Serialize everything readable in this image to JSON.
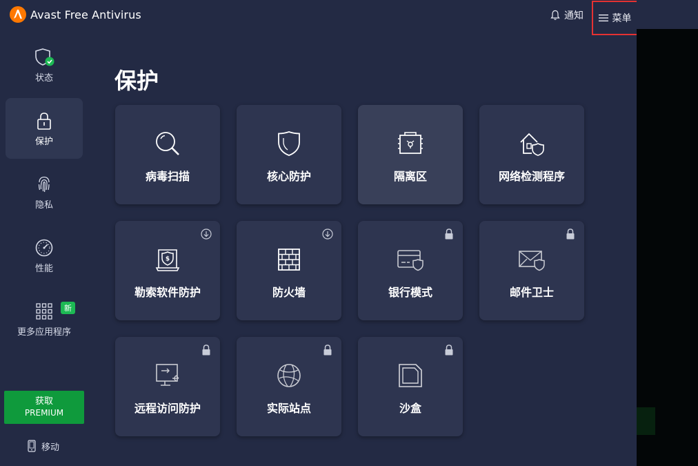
{
  "window": {
    "title": "Avast Free Antivirus",
    "notify_label": "通知",
    "menu_label": "菜单",
    "minimize_icon": "minimize-icon",
    "close_icon": "close-icon"
  },
  "sidebar": {
    "items": [
      {
        "label": "状态",
        "icon": "shield-check-icon"
      },
      {
        "label": "保护",
        "icon": "lock-icon"
      },
      {
        "label": "隐私",
        "icon": "fingerprint-icon"
      },
      {
        "label": "性能",
        "icon": "speedometer-icon"
      },
      {
        "label": "更多应用程序",
        "icon": "apps-grid-icon"
      }
    ],
    "new_badge": "新",
    "premium_line1": "获取",
    "premium_line2": "PREMIUM",
    "mobile_label": "移动"
  },
  "main": {
    "title": "保护",
    "tiles": [
      {
        "label": "病毒扫描",
        "icon": "magnifier-icon"
      },
      {
        "label": "核心防护",
        "icon": "shield-icon"
      },
      {
        "label": "隔离区",
        "icon": "quarantine-box-icon"
      },
      {
        "label": "网络检测程序",
        "icon": "home-shield-icon"
      },
      {
        "label": "勒索软件防护",
        "icon": "ransomware-shield-icon",
        "corner": "download-icon"
      },
      {
        "label": "防火墙",
        "icon": "firewall-icon",
        "corner": "download-icon"
      },
      {
        "label": "银行模式",
        "icon": "bank-card-icon",
        "corner": "lock-icon"
      },
      {
        "label": "邮件卫士",
        "icon": "mail-shield-icon",
        "corner": "lock-icon"
      },
      {
        "label": "远程访问防护",
        "icon": "remote-access-icon",
        "corner": "lock-icon"
      },
      {
        "label": "实际站点",
        "icon": "globe-icon",
        "corner": "lock-icon"
      },
      {
        "label": "沙盒",
        "icon": "sandbox-icon",
        "corner": "lock-icon"
      }
    ]
  },
  "colors": {
    "background": "#232a44",
    "tile": "#2e3550",
    "accent_green": "#0f9a3c",
    "logo_orange": "#ff7800",
    "highlight_red": "#e53232"
  }
}
